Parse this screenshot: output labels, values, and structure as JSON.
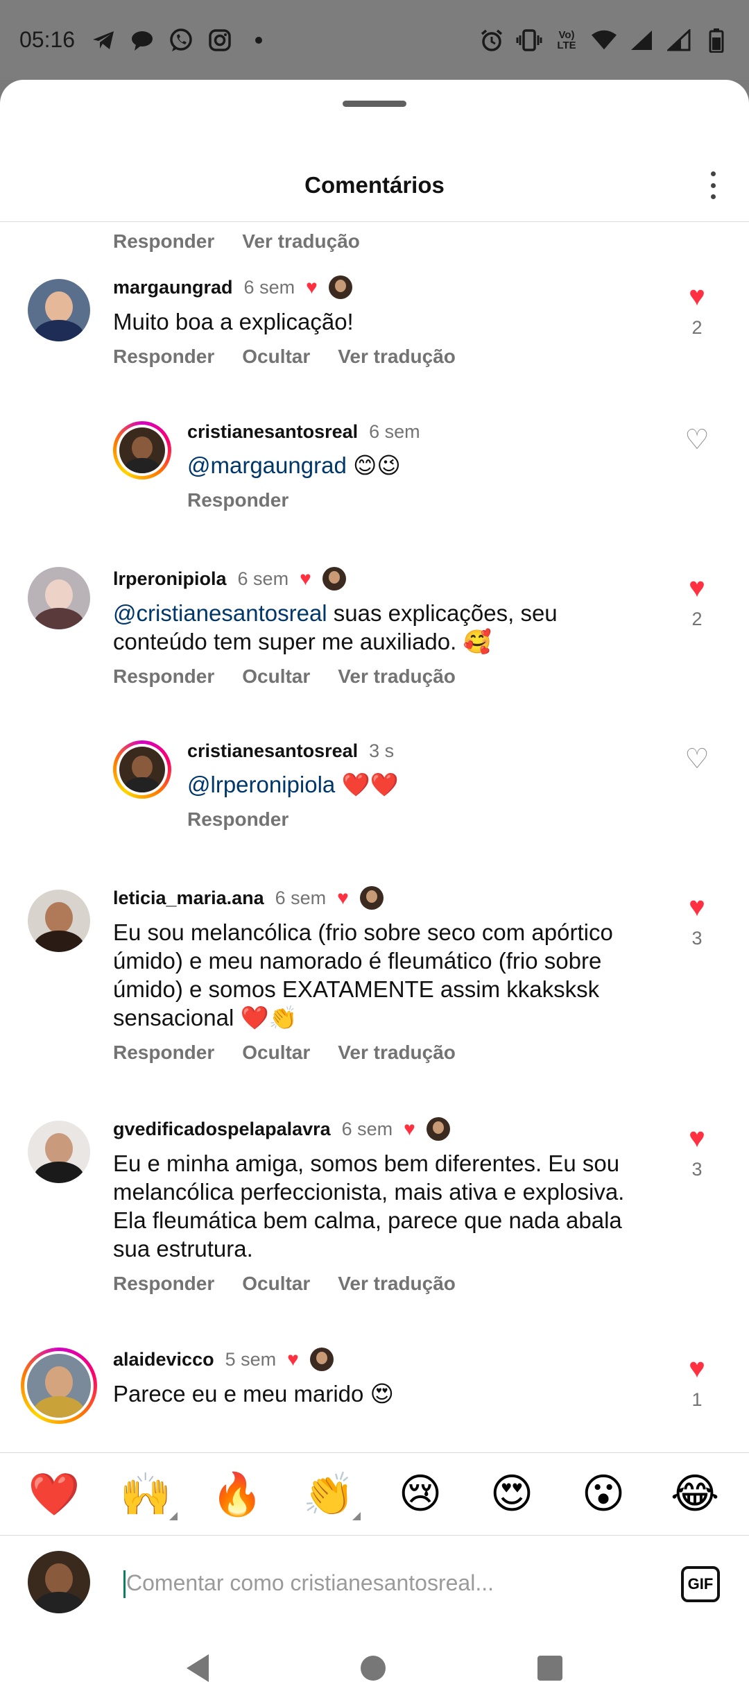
{
  "status_bar": {
    "time": "05:16",
    "left_icons": [
      "telegram-icon",
      "chat-bubble-icon",
      "whatsapp-icon",
      "instagram-icon",
      "dot-icon"
    ],
    "right_icons": [
      "alarm-icon",
      "vibrate-icon",
      "volte-icon",
      "wifi-icon",
      "signal-icon",
      "signal-icon-2",
      "battery-icon"
    ],
    "lte_label": "Vo) LTE"
  },
  "header": {
    "title": "Comentários"
  },
  "top_partial_actions": {
    "reply": "Responder",
    "translate": "Ver tradução"
  },
  "comments": [
    {
      "user": "margaungrad",
      "time": "6 sem",
      "text": "Muito  boa a explicação!",
      "reply": "Responder",
      "hide": "Ocultar",
      "translate": "Ver tradução",
      "likes": "2",
      "author_liked": true
    },
    {
      "user": "cristianesantosreal",
      "time": "6 sem",
      "mention": "@margaungrad",
      "text": " 😊😉",
      "reply": "Responder",
      "likes": ""
    },
    {
      "user": "lrperonipiola",
      "time": "6 sem",
      "mention": "@cristianesantosreal",
      "text": " suas explicações, seu conteúdo tem super me auxiliado. 🥰",
      "reply": "Responder",
      "hide": "Ocultar",
      "translate": "Ver tradução",
      "likes": "2",
      "author_liked": true
    },
    {
      "user": "cristianesantosreal",
      "time": "3 s",
      "mention": "@lrperonipiola",
      "text": " ❤️❤️",
      "reply": "Responder",
      "likes": ""
    },
    {
      "user": "leticia_maria.ana",
      "time": "6 sem",
      "text": "Eu sou melancólica (frio sobre seco com apórtico úmido) e meu namorado é fleumático (frio sobre úmido) e somos EXATAMENTE assim kkaksksk sensacional ❤️👏",
      "reply": "Responder",
      "hide": "Ocultar",
      "translate": "Ver tradução",
      "likes": "3",
      "author_liked": true
    },
    {
      "user": "gvedificadospelapalavra",
      "time": "6 sem",
      "text": "Eu e minha amiga, somos bem diferentes. Eu sou melancólica perfeccionista, mais ativa e explosiva. Ela fleumática bem calma, parece que nada abala sua estrutura.",
      "reply": "Responder",
      "hide": "Ocultar",
      "translate": "Ver tradução",
      "likes": "3",
      "author_liked": true
    },
    {
      "user": "alaidevicco",
      "time": "5 sem",
      "text": "Parece eu e meu marido 😍",
      "likes": "1",
      "author_liked": true
    }
  ],
  "emoji_bar": [
    "❤️",
    "🙌",
    "🔥",
    "👏",
    "😢",
    "😍",
    "😮",
    "😂"
  ],
  "composer": {
    "placeholder": "Comentar como cristianesantosreal...",
    "gif_label": "GIF"
  },
  "colors": {
    "like_red": "#ff3040",
    "mention_blue": "#00376b",
    "muted_gray": "#737373"
  }
}
